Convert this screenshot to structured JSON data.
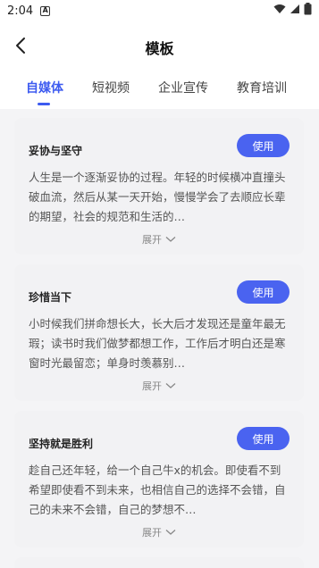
{
  "status": {
    "time": "2:04",
    "indicator": "A"
  },
  "nav": {
    "title": "模板"
  },
  "tabs": [
    {
      "label": "自媒体",
      "active": true
    },
    {
      "label": "短视频",
      "active": false
    },
    {
      "label": "企业宣传",
      "active": false
    },
    {
      "label": "教育培训",
      "active": false
    }
  ],
  "cards": [
    {
      "title": "妥协与坚守",
      "button": "使用",
      "body": "人生是一个逐渐妥协的过程。年轻的时候横冲直撞头破血流，然后从某一天开始，慢慢学会了去顺应长辈的期望，社会的规范和生活的…",
      "expand": "展开"
    },
    {
      "title": "珍惜当下",
      "button": "使用",
      "body": "小时候我们拼命想长大，长大后才发现还是童年最无瑕；读书时我们做梦都想工作，工作后才明白还是寒窗时光最留恋；单身时羡慕别…",
      "expand": "展开"
    },
    {
      "title": "坚持就是胜利",
      "button": "使用",
      "body": "趁自己还年轻，给一个自己牛x的机会。即使看不到希望即使看不到未来，也相信自己的选择不会错，自己的未来不会错，自己的梦想不…",
      "expand": "展开"
    }
  ],
  "colors": {
    "accent": "#4a63f0",
    "tab_active": "#3d5bf0"
  }
}
